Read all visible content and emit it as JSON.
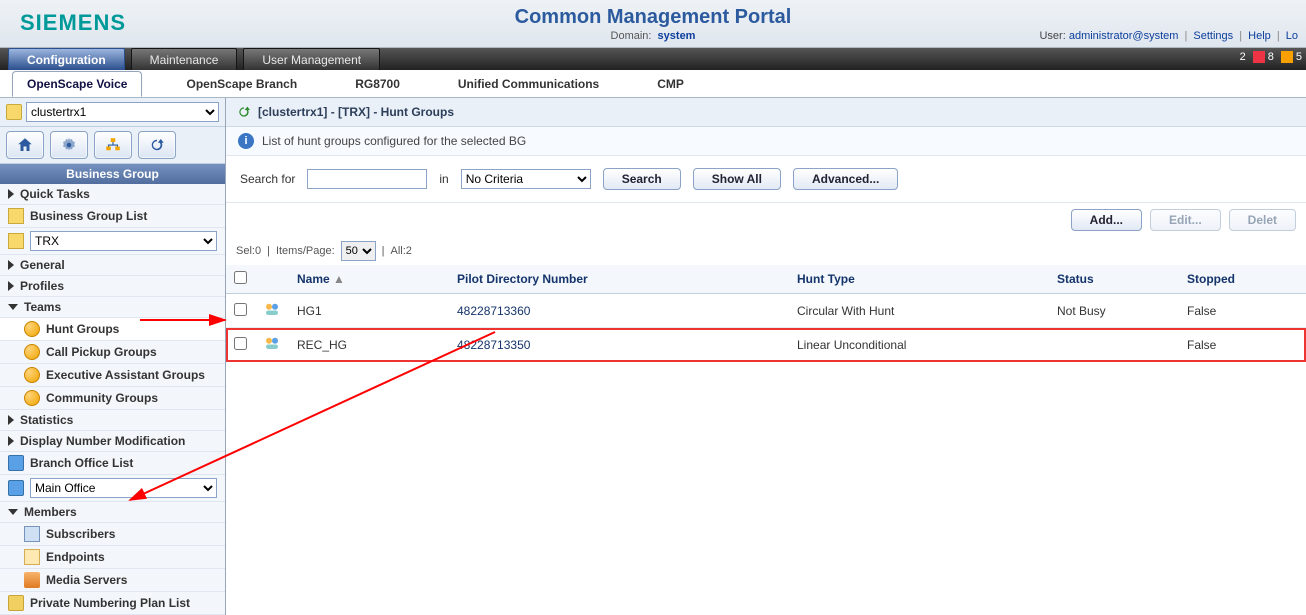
{
  "header": {
    "brand": "SIEMENS",
    "title": "Common Management Portal",
    "domain_label": "Domain:",
    "domain_value": "system",
    "user_label": "User:",
    "user_value": "administrator@system",
    "link_settings": "Settings",
    "link_help": "Help",
    "link_logout": "Lo",
    "status": {
      "a": "2",
      "b": "8",
      "c": "5"
    }
  },
  "main_tabs": {
    "configuration": "Configuration",
    "maintenance": "Maintenance",
    "user_management": "User Management"
  },
  "sub_tabs": {
    "osv": "OpenScape Voice",
    "branch": "OpenScape Branch",
    "rg": "RG8700",
    "uc": "Unified Communications",
    "cmp": "CMP"
  },
  "left": {
    "cluster_options": "clustertrx1",
    "bg_title": "Business Group",
    "quick_tasks": "Quick Tasks",
    "bg_list": "Business Group List",
    "bg_select": "TRX",
    "general": "General",
    "profiles": "Profiles",
    "teams": "Teams",
    "hunt_groups": "Hunt Groups",
    "call_pickup": "Call Pickup Groups",
    "exec_asst": "Executive Assistant Groups",
    "community": "Community Groups",
    "statistics": "Statistics",
    "dnm": "Display Number Modification",
    "branch_list": "Branch Office List",
    "main_office": "Main Office",
    "members": "Members",
    "subscribers": "Subscribers",
    "endpoints": "Endpoints",
    "media_servers": "Media Servers",
    "private_numbering": "Private Numbering Plan List"
  },
  "crumb": {
    "text": "[clustertrx1] - [TRX] - Hunt Groups"
  },
  "info": {
    "text": "List of hunt groups configured for the selected BG"
  },
  "search": {
    "label": "Search for",
    "in": "in",
    "criteria": "No Criteria",
    "btn_search": "Search",
    "btn_showall": "Show All",
    "btn_advanced": "Advanced..."
  },
  "actions": {
    "add": "Add...",
    "edit": "Edit...",
    "delete": "Delet"
  },
  "pager": {
    "sel": "Sel:0",
    "ipp_label": "Items/Page:",
    "ipp_value": "50",
    "all": "All:2"
  },
  "table": {
    "cols": {
      "name": "Name",
      "pilot": "Pilot Directory Number",
      "hunt": "Hunt Type",
      "status": "Status",
      "stopped": "Stopped"
    },
    "rows": [
      {
        "name": "HG1",
        "pilot": "48228713360",
        "hunt": "Circular With Hunt",
        "status": "Not Busy",
        "stopped": "False"
      },
      {
        "name": "REC_HG",
        "pilot": "48228713350",
        "hunt": "Linear Unconditional",
        "status": "",
        "stopped": "False"
      }
    ]
  }
}
